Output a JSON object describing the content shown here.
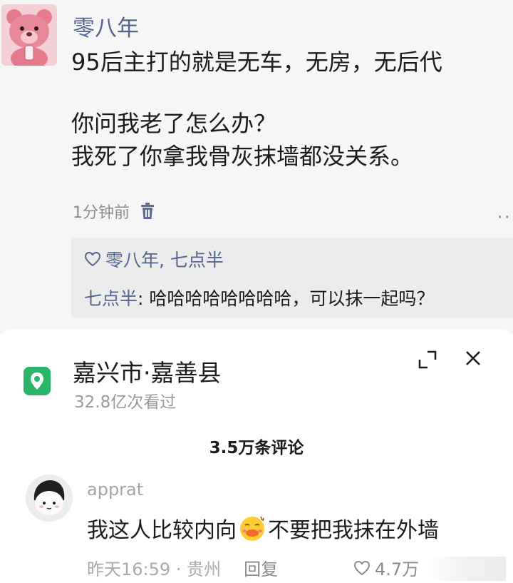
{
  "post": {
    "author": "零八年",
    "lines": [
      "95后主打的就是无车，无房，无后代",
      "你问我老了怎么办？",
      "我死了你拿我骨灰抹墙都没关系。"
    ],
    "time": "1分钟前",
    "more": "··",
    "likes": "零八年, 七点半",
    "reply": {
      "author": "七点半",
      "separator": ": ",
      "text": "哈哈哈哈哈哈哈哈，可以抹一起吗？"
    }
  },
  "sheet": {
    "location_title": "嘉兴市·嘉善县",
    "views": "32.8亿次看过",
    "comment_count": "3.5万条评论",
    "icons": [
      "location-pin-icon",
      "expand-icon",
      "close-icon"
    ],
    "comment": {
      "user": "apprat",
      "text_before": "我这人比较内向",
      "emoji": "shy-face-emoji",
      "text_after": "不要把我抹在外墙",
      "time": "昨天16:59",
      "dot": "·",
      "region": "贵州",
      "reply_label": "回复",
      "like_count": "4.7万"
    }
  },
  "colors": {
    "name_blue": "#56658f",
    "location_green": "#2bb56a",
    "meta_gray": "#a9a9a9"
  }
}
